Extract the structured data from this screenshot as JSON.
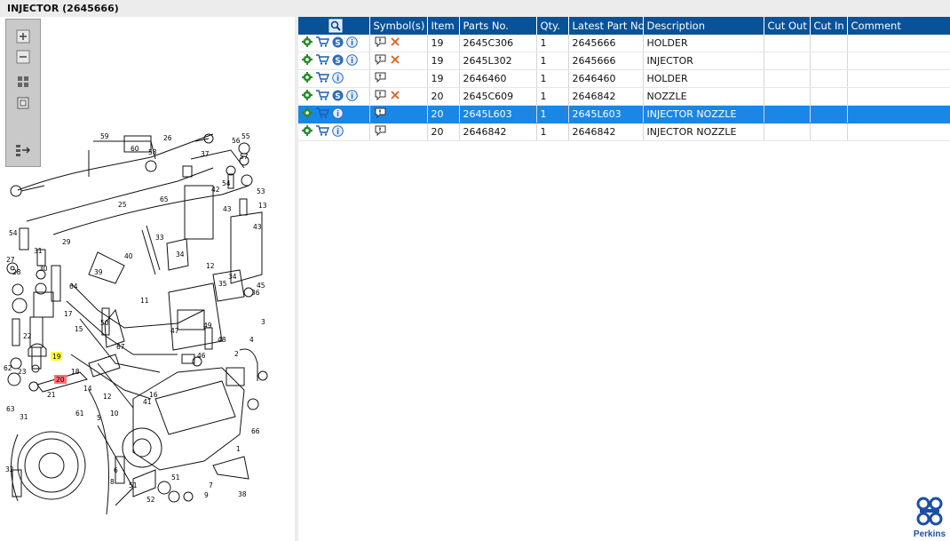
{
  "title": "INJECTOR (2645666)",
  "colors": {
    "header_blue": "#0a5298",
    "selected_blue": "#1a86e6",
    "highlight_yellow": "#ffff33",
    "highlight_red": "#ff7070",
    "brand": "#1b4fa6"
  },
  "zoom_toolbar": {
    "buttons": [
      {
        "name": "zoom-in",
        "icon": "plus-icon"
      },
      {
        "name": "zoom-out",
        "icon": "minus-icon"
      },
      {
        "name": "fit-all",
        "icon": "grid-icon"
      },
      {
        "name": "fit-window",
        "icon": "square-icon"
      },
      {
        "name": "toggle-list",
        "icon": "list-arrow-icon"
      }
    ]
  },
  "table": {
    "headers": [
      "",
      "Symbol(s)",
      "Item",
      "Parts No.",
      "Qty.",
      "Latest Part No.",
      "Description",
      "Cut Out",
      "Cut In",
      "Comment"
    ],
    "rows": [
      {
        "icons": [
          "gear-icon",
          "cart-icon",
          "s-icon",
          "info-icon"
        ],
        "symbols": [
          "note-icon",
          "cross-icon"
        ],
        "item": "19",
        "part": "2645C306",
        "qty": "1",
        "latest": "2645666",
        "desc": "HOLDER",
        "cut_out": "",
        "cut_in": "",
        "comment": "",
        "selected": false
      },
      {
        "icons": [
          "gear-icon",
          "cart-icon",
          "s-icon",
          "info-icon"
        ],
        "symbols": [
          "note-icon",
          "cross-icon"
        ],
        "item": "19",
        "part": "2645L302",
        "qty": "1",
        "latest": "2645666",
        "desc": "INJECTOR",
        "cut_out": "",
        "cut_in": "",
        "comment": "",
        "selected": false
      },
      {
        "icons": [
          "gear-icon",
          "cart-icon",
          "info-icon"
        ],
        "symbols": [
          "note-icon"
        ],
        "item": "19",
        "part": "2646460",
        "qty": "1",
        "latest": "2646460",
        "desc": "HOLDER",
        "cut_out": "",
        "cut_in": "",
        "comment": "",
        "selected": false
      },
      {
        "icons": [
          "gear-icon",
          "cart-icon",
          "s-icon",
          "info-icon"
        ],
        "symbols": [
          "note-icon",
          "cross-icon"
        ],
        "item": "20",
        "part": "2645C609",
        "qty": "1",
        "latest": "2646842",
        "desc": "NOZZLE",
        "cut_out": "",
        "cut_in": "",
        "comment": "",
        "selected": false
      },
      {
        "icons": [
          "gear-icon",
          "cart-icon",
          "info-icon"
        ],
        "symbols": [
          "note-icon"
        ],
        "item": "20",
        "part": "2645L603",
        "qty": "1",
        "latest": "2645L603",
        "desc": "INJECTOR NOZZLE",
        "cut_out": "",
        "cut_in": "",
        "comment": "",
        "selected": true
      },
      {
        "icons": [
          "gear-icon",
          "cart-icon",
          "info-icon"
        ],
        "symbols": [
          "note-icon"
        ],
        "item": "20",
        "part": "2646842",
        "qty": "1",
        "latest": "2646842",
        "desc": "INJECTOR NOZZLE",
        "cut_out": "",
        "cut_in": "",
        "comment": "",
        "selected": false
      }
    ]
  },
  "diagram": {
    "callouts": [
      "59",
      "60",
      "58",
      "26",
      "56",
      "55",
      "37",
      "57",
      "54",
      "65",
      "53",
      "42",
      "43",
      "25",
      "13",
      "33",
      "43",
      "29",
      "54",
      "27",
      "31",
      "40",
      "39",
      "34",
      "12",
      "28",
      "30",
      "64",
      "11",
      "35",
      "45",
      "34",
      "36",
      "17",
      "50",
      "47",
      "49",
      "48",
      "22",
      "15",
      "67",
      "46",
      "2",
      "3",
      "4",
      "19",
      "18",
      "14",
      "16",
      "62",
      "23",
      "20",
      "21",
      "41",
      "12",
      "63",
      "61",
      "10",
      "66",
      "5",
      "31",
      "32",
      "1",
      "6",
      "8",
      "7",
      "38",
      "9",
      "52",
      "51",
      "51"
    ],
    "highlighted": [
      {
        "label": "19",
        "color": "yellow"
      },
      {
        "label": "20",
        "color": "red"
      }
    ]
  },
  "logo": {
    "text": "Perkins"
  }
}
